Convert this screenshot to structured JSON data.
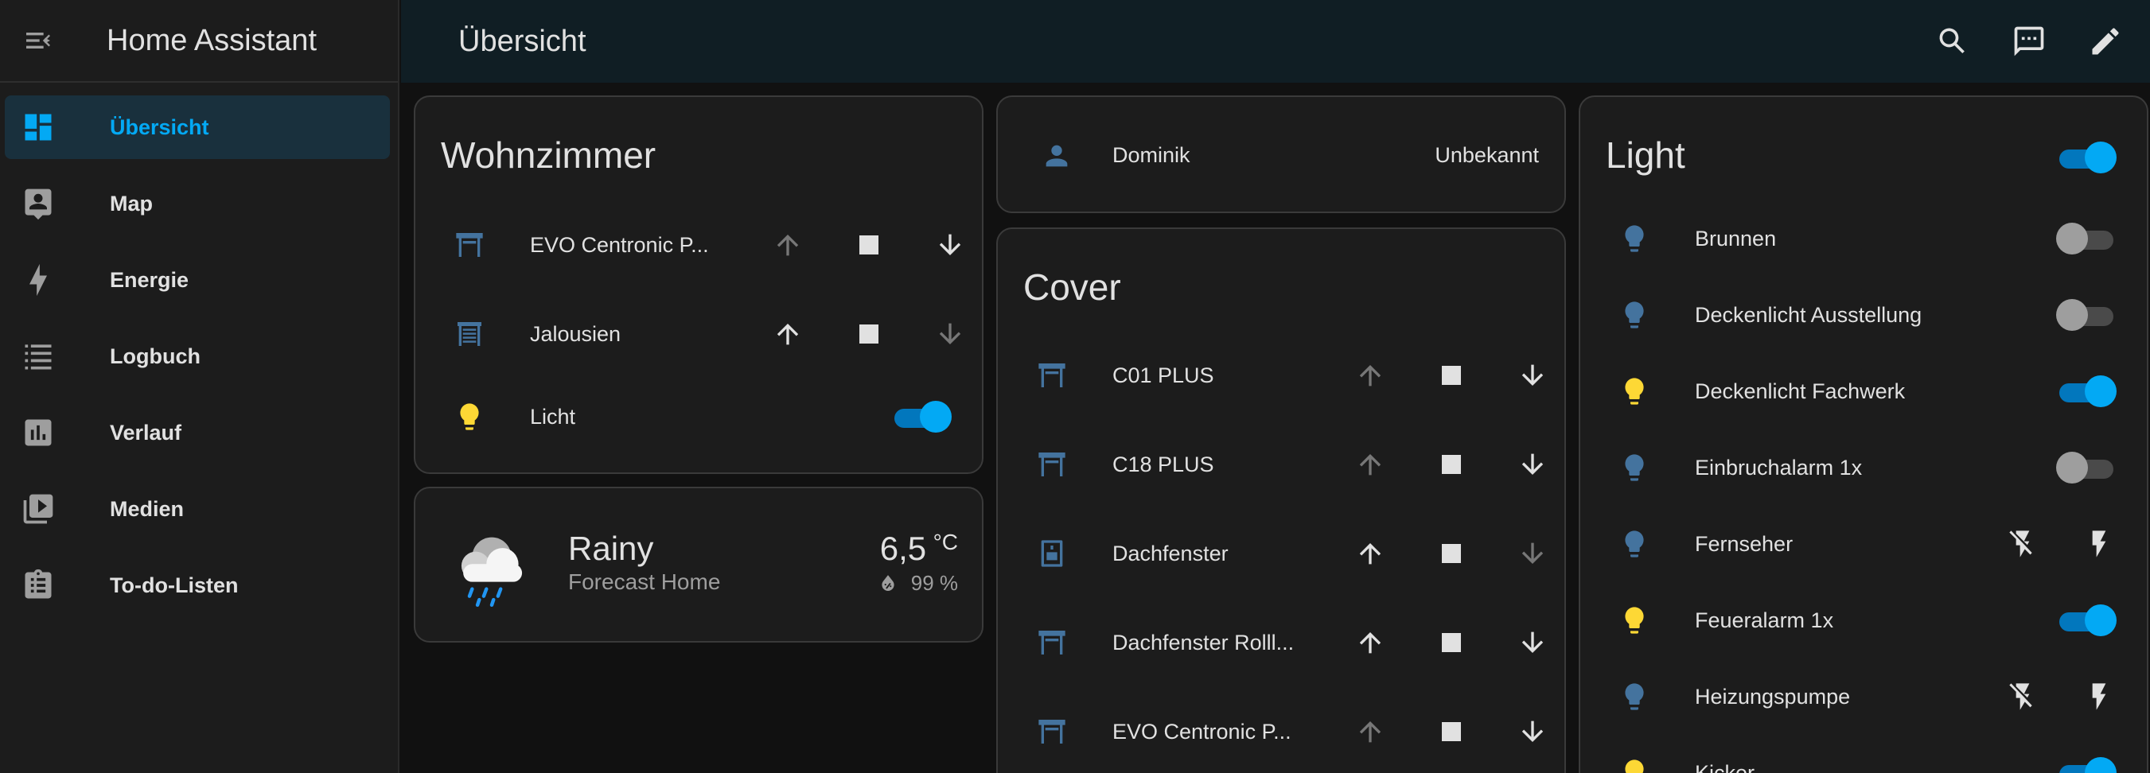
{
  "sidebar": {
    "title": "Home Assistant",
    "items": [
      {
        "label": "Übersicht",
        "icon": "dashboard-icon",
        "active": true
      },
      {
        "label": "Map",
        "icon": "map-account-icon"
      },
      {
        "label": "Energie",
        "icon": "lightning-icon"
      },
      {
        "label": "Logbuch",
        "icon": "logbook-list-icon"
      },
      {
        "label": "Verlauf",
        "icon": "chart-box-icon"
      },
      {
        "label": "Medien",
        "icon": "media-play-icon"
      },
      {
        "label": "To-do-Listen",
        "icon": "clipboard-list-icon"
      }
    ]
  },
  "topbar": {
    "title": "Übersicht",
    "actions": [
      "search-icon",
      "assist-chat-icon",
      "edit-pencil-icon"
    ]
  },
  "wohnzimmer": {
    "title": "Wohnzimmer",
    "rows": [
      {
        "name": "EVO Centronic P...",
        "type": "cover"
      },
      {
        "name": "Jalousien",
        "type": "cover"
      },
      {
        "name": "Licht",
        "type": "light",
        "on": true
      }
    ]
  },
  "weather": {
    "condition": "Rainy",
    "name": "Forecast Home",
    "temperature": "6,5",
    "unit": "°C",
    "humidity": "99 %"
  },
  "person": {
    "name": "Dominik",
    "state": "Unbekannt"
  },
  "cover": {
    "title": "Cover",
    "rows": [
      {
        "name": "C01 PLUS"
      },
      {
        "name": "C18 PLUS"
      },
      {
        "name": "Dachfenster"
      },
      {
        "name": "Dachfenster Rolll..."
      },
      {
        "name": "EVO Centronic P..."
      }
    ]
  },
  "light": {
    "title": "Light",
    "header_on": true,
    "rows": [
      {
        "name": "Brunnen",
        "state": "off"
      },
      {
        "name": "Deckenlicht Ausstellung",
        "state": "off"
      },
      {
        "name": "Deckenlicht Fachwerk",
        "state": "on"
      },
      {
        "name": "Einbruchalarm 1x",
        "state": "off"
      },
      {
        "name": "Fernseher",
        "state": "unknown"
      },
      {
        "name": "Feueralarm 1x",
        "state": "on"
      },
      {
        "name": "Heizungspumpe",
        "state": "unknown"
      },
      {
        "name": "Kicker",
        "state": "on"
      }
    ]
  },
  "colors": {
    "accent": "#03a9f4",
    "light_on": "#fdd835",
    "light_off": "#44739e"
  }
}
